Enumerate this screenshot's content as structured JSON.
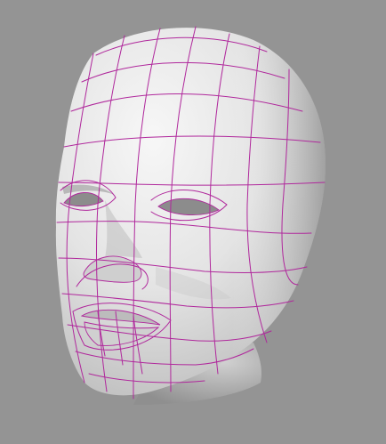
{
  "viewport": {
    "background": "#949494",
    "mesh_color": "#b0289c",
    "skin_light": "#f4f4f4",
    "skin_mid": "#d6d6d6",
    "skin_dark": "#a7a7a7"
  }
}
